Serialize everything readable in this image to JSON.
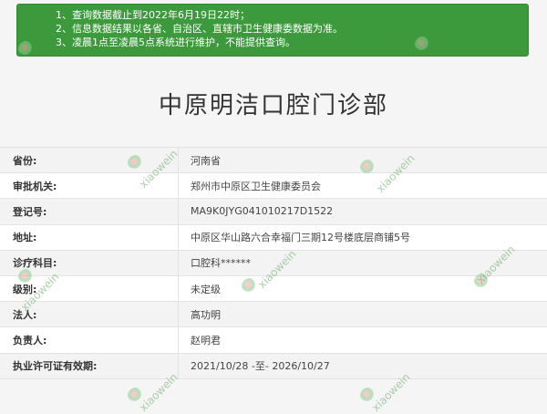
{
  "notice": {
    "lines": [
      "1、查询数据截止到2022年6月19日22时；",
      "2、信息数据结果以各省、自治区、直辖市卫生健康委数据为准。",
      "3、凌晨1点至凌晨5点系统进行维护，不能提供查询。"
    ]
  },
  "clinic": {
    "title": "中原明洁口腔门诊部"
  },
  "details": [
    {
      "label": "省份:",
      "value": "河南省"
    },
    {
      "label": "审批机关:",
      "value": "郑州市中原区卫生健康委员会"
    },
    {
      "label": "登记号:",
      "value": "MA9K0JYG041010217D1522"
    },
    {
      "label": "地址:",
      "value": "中原区华山路六合幸福门三期12号楼底层商铺5号"
    },
    {
      "label": "诊疗科目:",
      "value": "口腔科******"
    },
    {
      "label": "级别:",
      "value": "未定级"
    },
    {
      "label": "法人:",
      "value": "高功明"
    },
    {
      "label": "负责人:",
      "value": "赵明君"
    },
    {
      "label": "执业许可证有效期:",
      "value": "2021/10/28 -至- 2026/10/27"
    }
  ],
  "watermark": {
    "text": "xiaowein"
  }
}
